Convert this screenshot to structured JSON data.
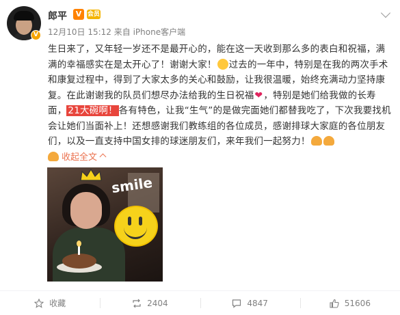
{
  "post": {
    "author": "郎平",
    "verified_badge": "V",
    "vip_icon": "V",
    "member_icon": "会员",
    "timestamp": "12月10日 15:12",
    "source": "来自 iPhone客户端",
    "text": {
      "p1": "生日来了，又年轻一岁还不是最开心的，能在这一天收到那么多的表白和祝福，满满的幸福感实在是太开心了！谢谢大家！",
      "p2": "过去的一年中，特别是在我的两次手术和康复过程中，得到了大家太多的关心和鼓励，让我很温暖，始终充满动力坚持康复。在此谢谢我的队员们想尽办法给我的生日祝福",
      "p3": "，特别是她们给我做的长寿面，",
      "highlight": "21大碗啊！",
      "p4": "各有特色，让我“生气”的是做完面她们都替我吃了，下次我要找机会让她们当面补上！还想感谢我们教练组的各位成员，感谢排球大家庭的各位朋友们，以及一直支持中国女排的球迷朋友们，来年我们一起努力！"
    },
    "collapse_label": "收起全文",
    "photo_text": "smile"
  },
  "actions": {
    "favorite_label": "收藏",
    "repost_count": "2404",
    "comment_count": "4847",
    "like_count": "51606"
  },
  "colors": {
    "accent": "#eb7350",
    "highlight_bg": "#e8453c",
    "meta": "#808080"
  },
  "icons": [
    "chevron-down-icon",
    "emoji-icon",
    "heart-icon",
    "flexed-arm-icon",
    "star-icon",
    "repost-icon",
    "comment-icon",
    "like-icon"
  ]
}
